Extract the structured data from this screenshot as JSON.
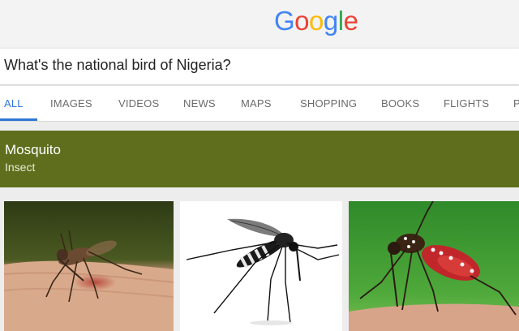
{
  "logo": {
    "letters": [
      "G",
      "o",
      "o",
      "g",
      "l",
      "e"
    ],
    "colors": [
      "#4285F4",
      "#EA4335",
      "#FBBC05",
      "#4285F4",
      "#34A853",
      "#EA4335"
    ]
  },
  "search": {
    "query": "What's the national bird of Nigeria?"
  },
  "tabs": [
    {
      "label": "ALL",
      "active": true
    },
    {
      "label": "IMAGES",
      "active": false
    },
    {
      "label": "VIDEOS",
      "active": false
    },
    {
      "label": "NEWS",
      "active": false
    },
    {
      "label": "MAPS",
      "active": false
    },
    {
      "label": "SHOPPING",
      "active": false
    },
    {
      "label": "BOOKS",
      "active": false
    },
    {
      "label": "FLIGHTS",
      "active": false
    },
    {
      "label": "P",
      "active": false
    }
  ],
  "answer": {
    "title": "Mosquito",
    "subtitle": "Insect",
    "color": "#5e6e1c"
  },
  "images": [
    {
      "subject": "mosquito-on-skin"
    },
    {
      "subject": "mosquito-white-background"
    },
    {
      "subject": "mosquito-feeding-green-background"
    }
  ],
  "accent": "#2f77d6"
}
